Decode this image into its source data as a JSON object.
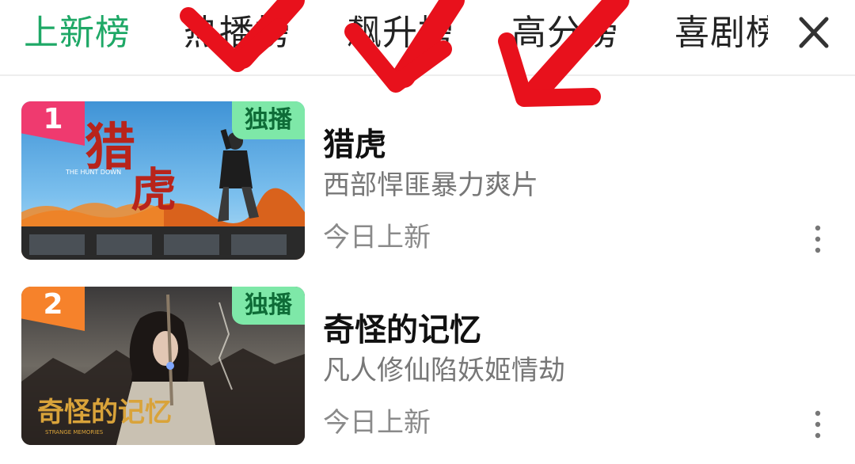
{
  "tabs": [
    {
      "label": "上新榜",
      "active": true
    },
    {
      "label": "热播榜",
      "active": false
    },
    {
      "label": "飙升榜",
      "active": false
    },
    {
      "label": "高分榜",
      "active": false
    },
    {
      "label": "喜剧榜",
      "active": false
    }
  ],
  "close_icon": "close-icon",
  "colors": {
    "accent": "#1ea866",
    "rank_1": "#ef3a6f",
    "rank_2": "#f6822b",
    "exclusive_bg": "#7ee8a8",
    "annotation_arrow": "#e8111c"
  },
  "items": [
    {
      "rank": "1",
      "badge": "独播",
      "title": "猎虎",
      "subtitle": "西部悍匪暴力爽片",
      "status": "今日上新",
      "poster_title": "猎虎",
      "poster_caption": "THE HUNT DOWN"
    },
    {
      "rank": "2",
      "badge": "独播",
      "title": "奇怪的记忆",
      "subtitle": "凡人修仙陷妖姬情劫",
      "status": "今日上新",
      "poster_title": "奇怪的记忆",
      "poster_caption": "STRANGE MEMORIES"
    }
  ]
}
